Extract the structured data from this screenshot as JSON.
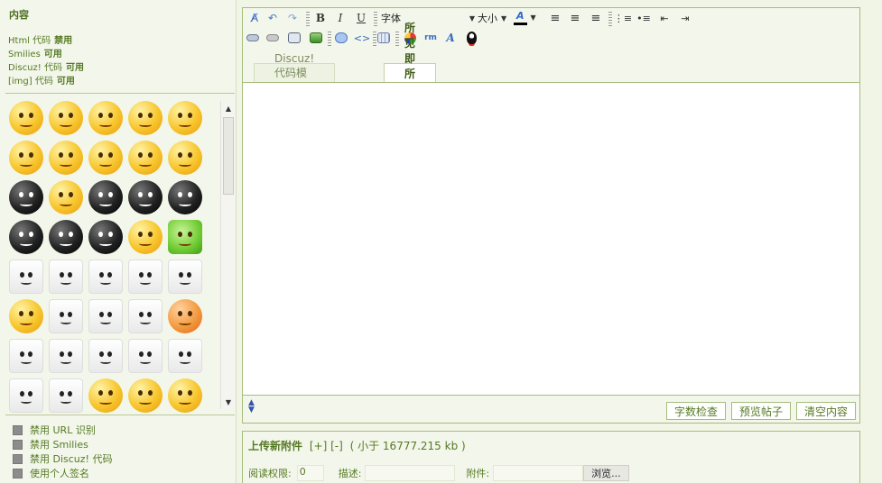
{
  "left": {
    "title": "内容",
    "status": [
      {
        "label": "Html 代码",
        "value": "禁用"
      },
      {
        "label": "Smilies",
        "value": "可用"
      },
      {
        "label": "Discuz! 代码",
        "value": "可用"
      },
      {
        "label": "[img] 代码",
        "value": "可用"
      }
    ],
    "options": [
      {
        "label": "禁用 URL 识别",
        "checked": false
      },
      {
        "label": "禁用 Smilies",
        "checked": false
      },
      {
        "label": "禁用 Discuz! 代码",
        "checked": false
      },
      {
        "label": "使用个人签名",
        "checked": false
      }
    ]
  },
  "toolbar": {
    "font_label": "字体",
    "size_label": "大小",
    "color_label": "A"
  },
  "tabs": [
    {
      "label": "Discuz! 代码模式",
      "active": false
    },
    {
      "label": "所见即所得模式",
      "active": true
    }
  ],
  "buttons": {
    "check_length": "字数检查",
    "preview": "预览帖子",
    "clear": "清空内容"
  },
  "upload": {
    "title": "上传新附件",
    "links": "[+] [-]",
    "limit": "( 小于 16777.215 kb )",
    "perm_label": "阅读权限:",
    "perm_value": "0",
    "desc_label": "描述:",
    "attach_label": "附件:",
    "browse_label": "浏览..."
  }
}
